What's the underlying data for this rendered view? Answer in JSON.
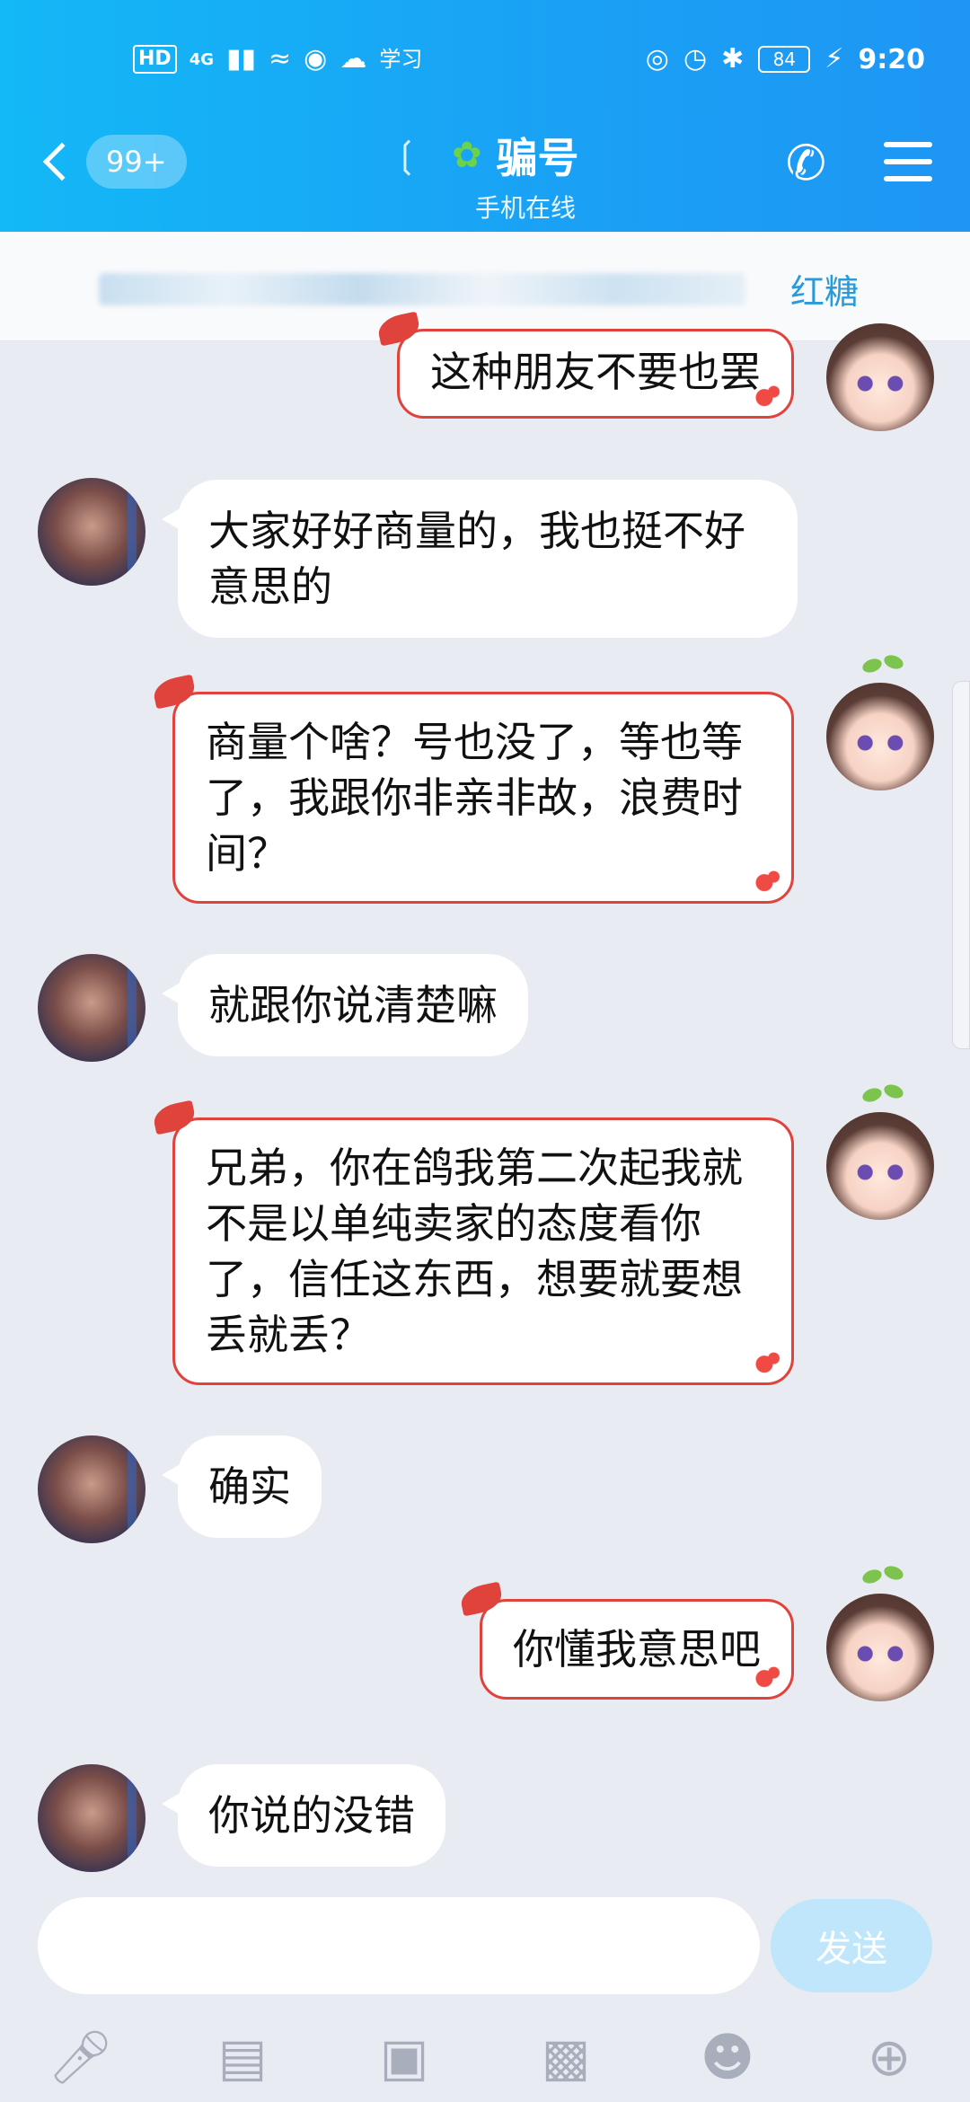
{
  "status_bar": {
    "network_label": "HD",
    "signal_label": "4G",
    "carrier_note": "学习",
    "battery": "84",
    "time": "9:20"
  },
  "header": {
    "unread_count": "99+",
    "title": "骗号",
    "subtitle": "手机在线"
  },
  "banner": {
    "visible_text": "红糖"
  },
  "messages": [
    {
      "side": "right",
      "text": "这种朋友不要也罢"
    },
    {
      "side": "left",
      "text": "大家好好商量的，我也挺不好意思的"
    },
    {
      "side": "right",
      "text": "商量个啥？号也没了，等也等了，我跟你非亲非故，浪费时间？"
    },
    {
      "side": "left",
      "text": "就跟你说清楚嘛"
    },
    {
      "side": "right",
      "text": "兄弟，你在鸽我第二次起我就不是以单纯卖家的态度看你了，信任这东西，想要就要想丢就丢？"
    },
    {
      "side": "left",
      "text": "确实"
    },
    {
      "side": "right",
      "text": "你懂我意思吧"
    },
    {
      "side": "left",
      "text": "你说的没错"
    }
  ],
  "input": {
    "value": "",
    "send_label": "发送"
  },
  "toolbar_icons": [
    "microphone-icon",
    "image-icon",
    "camera-icon",
    "red-packet-icon",
    "emoji-icon",
    "plus-icon"
  ],
  "colors": {
    "header_blue": "#15acf6",
    "bubble_border_red": "#e0423c",
    "chat_background": "#e8ebf2",
    "send_button": "#bfe6fb"
  }
}
